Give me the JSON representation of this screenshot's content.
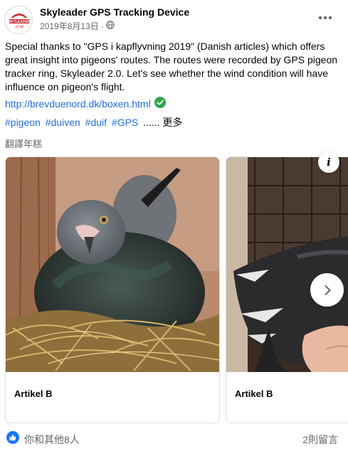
{
  "post": {
    "page_name": "Skyleader GPS Tracking Device",
    "date": "2019年8月13日",
    "date_separator": "·",
    "avatar_logo_text": "SKYLEADER",
    "body": "Special thanks to \"GPS i kapflyvning 2019\" (Danish articles) which offers great insight into pigeons' routes. The routes were recorded by GPS pigeon tracker ring, Skyleader 2.0. Let's see whether the wind condition will have influence on pigeon's flight.",
    "link": "http://brevduenord.dk/boxen.html",
    "hashtags": [
      "#pigeon",
      "#duiven",
      "#duif",
      "#GPS"
    ],
    "ellipsis": "......",
    "see_more": "更多",
    "translate": "翻譯年糕"
  },
  "carousel": {
    "cards": [
      {
        "title": "Artikel B"
      },
      {
        "title": "Artikel B"
      }
    ],
    "info_icon": "i"
  },
  "footer": {
    "reactions": "你和其他8人",
    "comments": "2則留言"
  },
  "icons": {
    "more": "ellipsis-horizontal-icon",
    "globe": "globe-icon",
    "verified": "verified-check-icon",
    "info": "info-icon",
    "next": "chevron-right-icon",
    "like": "thumbs-up-icon"
  },
  "colors": {
    "link": "#216fdb",
    "meta_text": "#65676b",
    "verified": "#31a24c",
    "like_blue": "#1877f2"
  }
}
